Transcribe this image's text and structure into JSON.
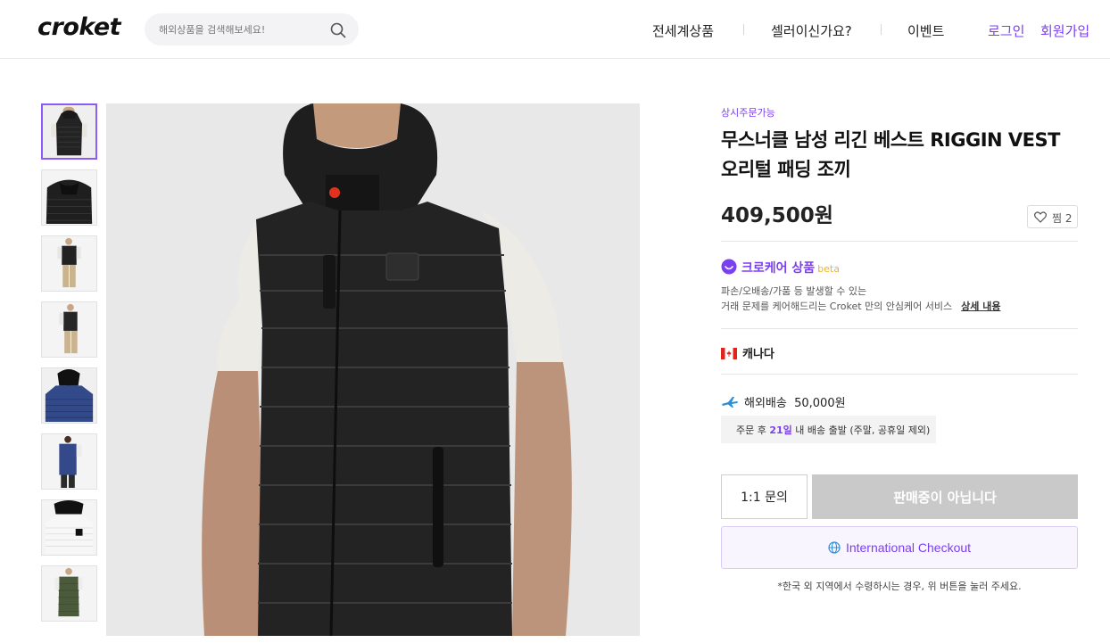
{
  "header": {
    "logo": "croket",
    "search_placeholder": "해외상품을 검색해보세요!",
    "nav": {
      "global_products": "전세계상품",
      "seller": "셀러이신가요?",
      "events": "이벤트",
      "login": "로그인",
      "signup": "회원가입"
    }
  },
  "product": {
    "tag": "상시주문가능",
    "title": "무스너클 남성 리긴 베스트 RIGGIN VEST 오리털 패딩 조끼",
    "price": "409,500원",
    "wishlist_label": "찜",
    "wishlist_count": "2",
    "care": {
      "title": "크로케어 상품",
      "beta": "beta",
      "desc_line1": "파손/오배송/가품 등 발생할 수 있는",
      "desc_line2": "거래 문제를 케어해드리는 Croket 만의 안심케어 서비스",
      "detail_link": "상세 내용"
    },
    "country": "캐나다",
    "shipping": {
      "label": "해외배송",
      "fee": "50,000원",
      "dispatch_prefix": "주문 후",
      "dispatch_days": "21일",
      "dispatch_suffix": "내 배송 출발 (주말, 공휴일 제외)"
    },
    "buttons": {
      "inquiry": "1:1 문의",
      "sold_out": "판매중이 아닙니다",
      "international_checkout": "International Checkout"
    },
    "note": "*한국 외 지역에서 수령하시는 경우, 위 버튼을 눌러 주세요."
  },
  "thumbnails": [
    {
      "variant": "black-vest-front",
      "active": true
    },
    {
      "variant": "black-vest-flat"
    },
    {
      "variant": "black-vest-model-full"
    },
    {
      "variant": "black-vest-model-side"
    },
    {
      "variant": "blue-vest-model"
    },
    {
      "variant": "blue-vest-model-side"
    },
    {
      "variant": "white-vest-model"
    },
    {
      "variant": "green-vest-model"
    }
  ],
  "colors": {
    "accent": "#7b3ff2",
    "beta": "#f0b429",
    "sold_out_bg": "#c9c9c9"
  },
  "icons": [
    "search-icon",
    "heart-icon",
    "smile-icon",
    "canada-flag-icon",
    "airplane-icon",
    "globe-icon"
  ]
}
